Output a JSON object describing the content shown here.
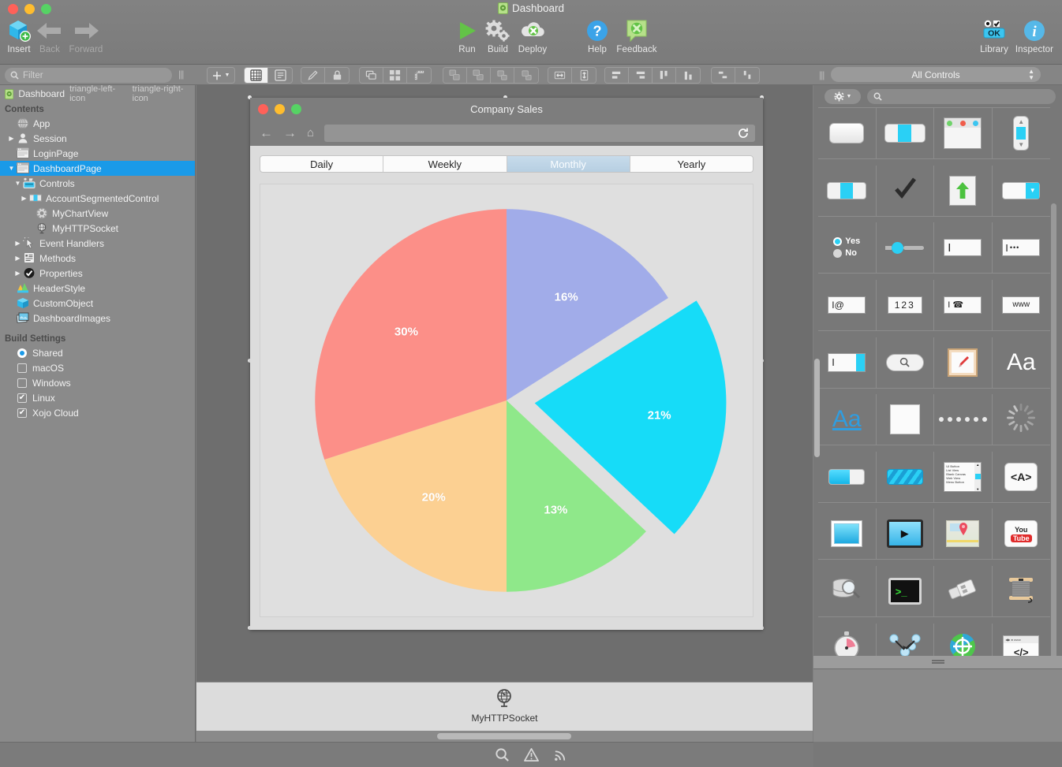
{
  "app": {
    "window_title": "Dashboard",
    "window_title_icon": "xojo-project-icon"
  },
  "toolbar": {
    "items": [
      {
        "label": "Insert",
        "icon": "insert-cube-plus-icon",
        "enabled": true
      },
      {
        "label": "Back",
        "icon": "arrow-left-icon",
        "enabled": false
      },
      {
        "label": "Forward",
        "icon": "arrow-right-icon",
        "enabled": false
      },
      {
        "label": "Run",
        "icon": "play-triangle-icon",
        "enabled": true
      },
      {
        "label": "Build",
        "icon": "gears-icon",
        "enabled": true
      },
      {
        "label": "Deploy",
        "icon": "cloud-upload-icon",
        "enabled": true
      },
      {
        "label": "Help",
        "icon": "question-circle-icon",
        "enabled": true
      },
      {
        "label": "Feedback",
        "icon": "speech-bubble-icon",
        "enabled": true
      },
      {
        "label": "Library",
        "icon": "library-ok-icon",
        "enabled": true
      },
      {
        "label": "Inspector",
        "icon": "info-circle-icon",
        "enabled": true
      }
    ]
  },
  "filter": {
    "placeholder": "Filter",
    "value": "",
    "icon": "search-icon"
  },
  "toolbar2": {
    "add_label": "+",
    "groups": [
      {
        "name": "view-mode",
        "buttons": [
          {
            "icon": "grid-view-icon",
            "active": true
          },
          {
            "icon": "list-view-icon",
            "active": false
          }
        ]
      },
      {
        "name": "edit-lock",
        "buttons": [
          {
            "icon": "pencil-icon",
            "active": false
          },
          {
            "icon": "lock-icon",
            "active": false
          }
        ]
      },
      {
        "name": "layout-tools",
        "buttons": [
          {
            "icon": "duplicate-icon",
            "active": false
          },
          {
            "icon": "layout-grid-icon",
            "active": false
          },
          {
            "icon": "ruler-icon",
            "active": false
          }
        ]
      },
      {
        "name": "order-tools",
        "buttons": [
          {
            "icon": "bring-front-icon",
            "active": false
          },
          {
            "icon": "send-back-icon",
            "active": false
          },
          {
            "icon": "bring-forward-icon",
            "active": false
          },
          {
            "icon": "send-backward-icon",
            "active": false
          }
        ]
      },
      {
        "name": "size-tools",
        "buttons": [
          {
            "icon": "match-width-icon",
            "active": false
          },
          {
            "icon": "match-height-icon",
            "active": false
          }
        ]
      },
      {
        "name": "align-tools",
        "buttons": [
          {
            "icon": "align-left-icon",
            "active": false
          },
          {
            "icon": "align-right-icon",
            "active": false
          },
          {
            "icon": "align-top-icon",
            "active": false
          },
          {
            "icon": "align-bottom-icon",
            "active": false
          }
        ]
      },
      {
        "name": "distribute-tools",
        "buttons": [
          {
            "icon": "distribute-horizontal-icon",
            "active": false
          },
          {
            "icon": "distribute-vertical-icon",
            "active": false
          }
        ]
      }
    ]
  },
  "navigator": {
    "project_name": "Dashboard",
    "project_icon": "xojo-project-icon",
    "prev_icon": "triangle-left-icon",
    "next_icon": "triangle-right-icon",
    "contents_header": "Contents",
    "tree": [
      {
        "label": "App",
        "icon": "app-icon",
        "indent": 1,
        "twisty": "",
        "selected": false
      },
      {
        "label": "Session",
        "icon": "session-icon",
        "indent": 1,
        "twisty": "▶",
        "selected": false
      },
      {
        "label": "LoginPage",
        "icon": "webpage-icon",
        "indent": 1,
        "twisty": "",
        "selected": false
      },
      {
        "label": "DashboardPage",
        "icon": "webpage-icon",
        "indent": 1,
        "twisty": "▼",
        "selected": true
      },
      {
        "label": "Controls",
        "icon": "controls-icon",
        "indent": 2,
        "twisty": "▼",
        "selected": false
      },
      {
        "label": "AccountSegmentedControl",
        "icon": "segmented-icon",
        "indent": 3,
        "twisty": "▶",
        "selected": false
      },
      {
        "label": "MyChartView",
        "icon": "chartview-icon",
        "indent": 4,
        "twisty": "",
        "selected": false
      },
      {
        "label": "MyHTTPSocket",
        "icon": "globe-icon",
        "indent": 4,
        "twisty": "",
        "selected": false
      },
      {
        "label": "Event Handlers",
        "icon": "events-icon",
        "indent": 2,
        "twisty": "▶",
        "selected": false
      },
      {
        "label": "Methods",
        "icon": "methods-icon",
        "indent": 2,
        "twisty": "▶",
        "selected": false
      },
      {
        "label": "Properties",
        "icon": "properties-icon",
        "indent": 2,
        "twisty": "▶",
        "selected": false
      },
      {
        "label": "HeaderStyle",
        "icon": "style-icon",
        "indent": 1,
        "twisty": "",
        "selected": false
      },
      {
        "label": "CustomObject",
        "icon": "cube-icon",
        "indent": 1,
        "twisty": "",
        "selected": false
      },
      {
        "label": "DashboardImages",
        "icon": "images-icon",
        "indent": 1,
        "twisty": "",
        "selected": false
      }
    ],
    "build_settings_header": "Build Settings",
    "build_targets": [
      {
        "label": "Shared",
        "control": "radio",
        "checked": true
      },
      {
        "label": "macOS",
        "control": "checkbox",
        "checked": false
      },
      {
        "label": "Windows",
        "control": "checkbox",
        "checked": false
      },
      {
        "label": "Linux",
        "control": "checkbox",
        "checked": true
      },
      {
        "label": "Xojo Cloud",
        "control": "checkbox",
        "checked": true
      }
    ]
  },
  "editor": {
    "browser_window": {
      "title": "Company Sales",
      "back_icon": "arrow-left-icon",
      "forward_icon": "arrow-right-icon",
      "home_icon": "home-icon",
      "reload_icon": "reload-icon",
      "url_value": ""
    },
    "segmented_control": {
      "name": "AccountSegmentedControl",
      "segments": [
        "Daily",
        "Weekly",
        "Monthly",
        "Yearly"
      ],
      "selected_index": 2
    }
  },
  "chart_data": {
    "type": "pie",
    "title": "Company Sales",
    "labels": [
      "16%",
      "21%",
      "13%",
      "20%",
      "30%"
    ],
    "values": [
      16,
      21,
      13,
      20,
      30
    ],
    "colors": [
      "#a1ace9",
      "#16dcf8",
      "#8fe88a",
      "#fcd092",
      "#fc8f88"
    ],
    "exploded": [
      false,
      true,
      false,
      false,
      false
    ],
    "start_angle_deg": 0,
    "legend": "none",
    "grid": false,
    "background": "#dfdfdf"
  },
  "shelf": {
    "items": [
      {
        "label": "MyHTTPSocket",
        "icon": "globe-icon"
      }
    ]
  },
  "statusbar": {
    "icons": [
      {
        "name": "search-icon"
      },
      {
        "name": "warning-triangle-icon"
      },
      {
        "name": "broadcast-icon"
      }
    ]
  },
  "library": {
    "category_label": "All Controls",
    "chevron_icon": "updown-chevron-icon",
    "gear_icon": "gear-icon",
    "search": {
      "placeholder": "",
      "value": "",
      "icon": "search-icon"
    },
    "footer_icon": "resize-grip-icon",
    "controls": [
      "button-icon",
      "segmented-control-icon",
      "container-window-icon",
      "scrollbar-icon",
      "bevel-button-icon",
      "checkbox-icon",
      "upload-button-icon",
      "popup-menu-icon",
      "radio-group-icon",
      "slider-icon",
      "text-field-icon",
      "password-field-icon",
      "email-field-icon",
      "number-field-icon",
      "phone-field-icon",
      "url-field-icon",
      "search-field-stepper-icon",
      "search-field-icon",
      "canvas-paint-icon",
      "label-icon",
      "link-label-icon",
      "rectangle-icon",
      "progress-dots-icon",
      "progress-wheel-icon",
      "progress-bar-icon",
      "striped-progress-icon",
      "list-box-icon",
      "html-viewer-icon",
      "image-view-icon",
      "movie-player-icon",
      "map-viewer-icon",
      "youtube-viewer-icon",
      "database-query-icon",
      "shell-icon",
      "usb-serial-icon",
      "thread-spool-icon",
      "timer-icon",
      "sockets-icon",
      "http-socket-icon",
      "xml-code-icon",
      "system-gear-icon",
      "file-script-icon",
      "browser-window-icon",
      "web-globe-icon"
    ]
  }
}
